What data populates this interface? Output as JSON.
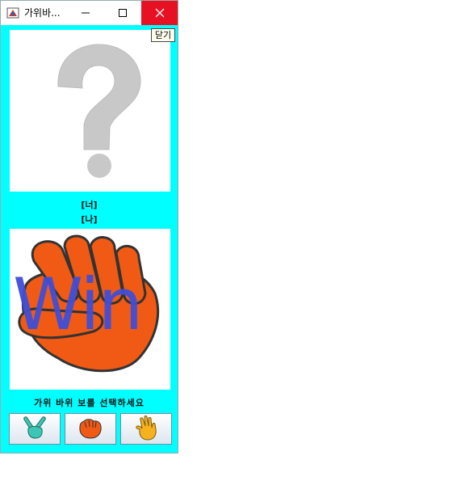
{
  "window": {
    "title": "가위바...",
    "close_tooltip_button": "닫기"
  },
  "labels": {
    "you": "[너]",
    "me": "[나]",
    "prompt": "가위 바위 보를 선택하세요"
  },
  "result": {
    "text": "Win"
  },
  "choices": [
    {
      "name": "scissors",
      "icon": "scissors-hand-icon"
    },
    {
      "name": "rock",
      "icon": "rock-fist-icon"
    },
    {
      "name": "paper",
      "icon": "paper-hand-icon"
    }
  ],
  "colors": {
    "background": "#00ffff",
    "close_button": "#e81123",
    "question_mark": "#c8c8c8",
    "fist": "#f05a14",
    "win_text": "#3f4fd8"
  }
}
